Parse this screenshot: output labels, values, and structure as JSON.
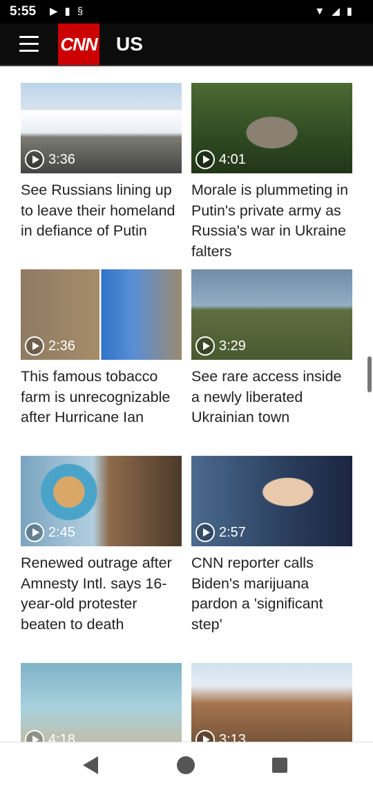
{
  "status_bar": {
    "time": "5:55"
  },
  "header": {
    "section_title": "US",
    "logo_text": "CNN"
  },
  "videos": [
    {
      "duration": "3:36",
      "title": "See Russians lining up to leave their homeland in defiance of Putin"
    },
    {
      "duration": "4:01",
      "title": "Morale is plummeting in Putin's private army as Russia's war in Ukraine falters"
    },
    {
      "duration": "2:36",
      "title": "This famous tobacco farm is unrecognizable after Hurricane Ian"
    },
    {
      "duration": "3:29",
      "title": "See rare access inside a newly liberated Ukrainian town"
    },
    {
      "duration": "2:45",
      "title": "Renewed outrage after Amnesty Intl. says 16-year-old protester beaten to death"
    },
    {
      "duration": "2:57",
      "title": "CNN reporter calls Biden's marijuana pardon a 'significant step'"
    },
    {
      "duration": "4:18",
      "title": ""
    },
    {
      "duration": "3:13",
      "title": ""
    }
  ],
  "colors": {
    "brand_red": "#cc0000",
    "header_bg": "#0c0c0c"
  }
}
